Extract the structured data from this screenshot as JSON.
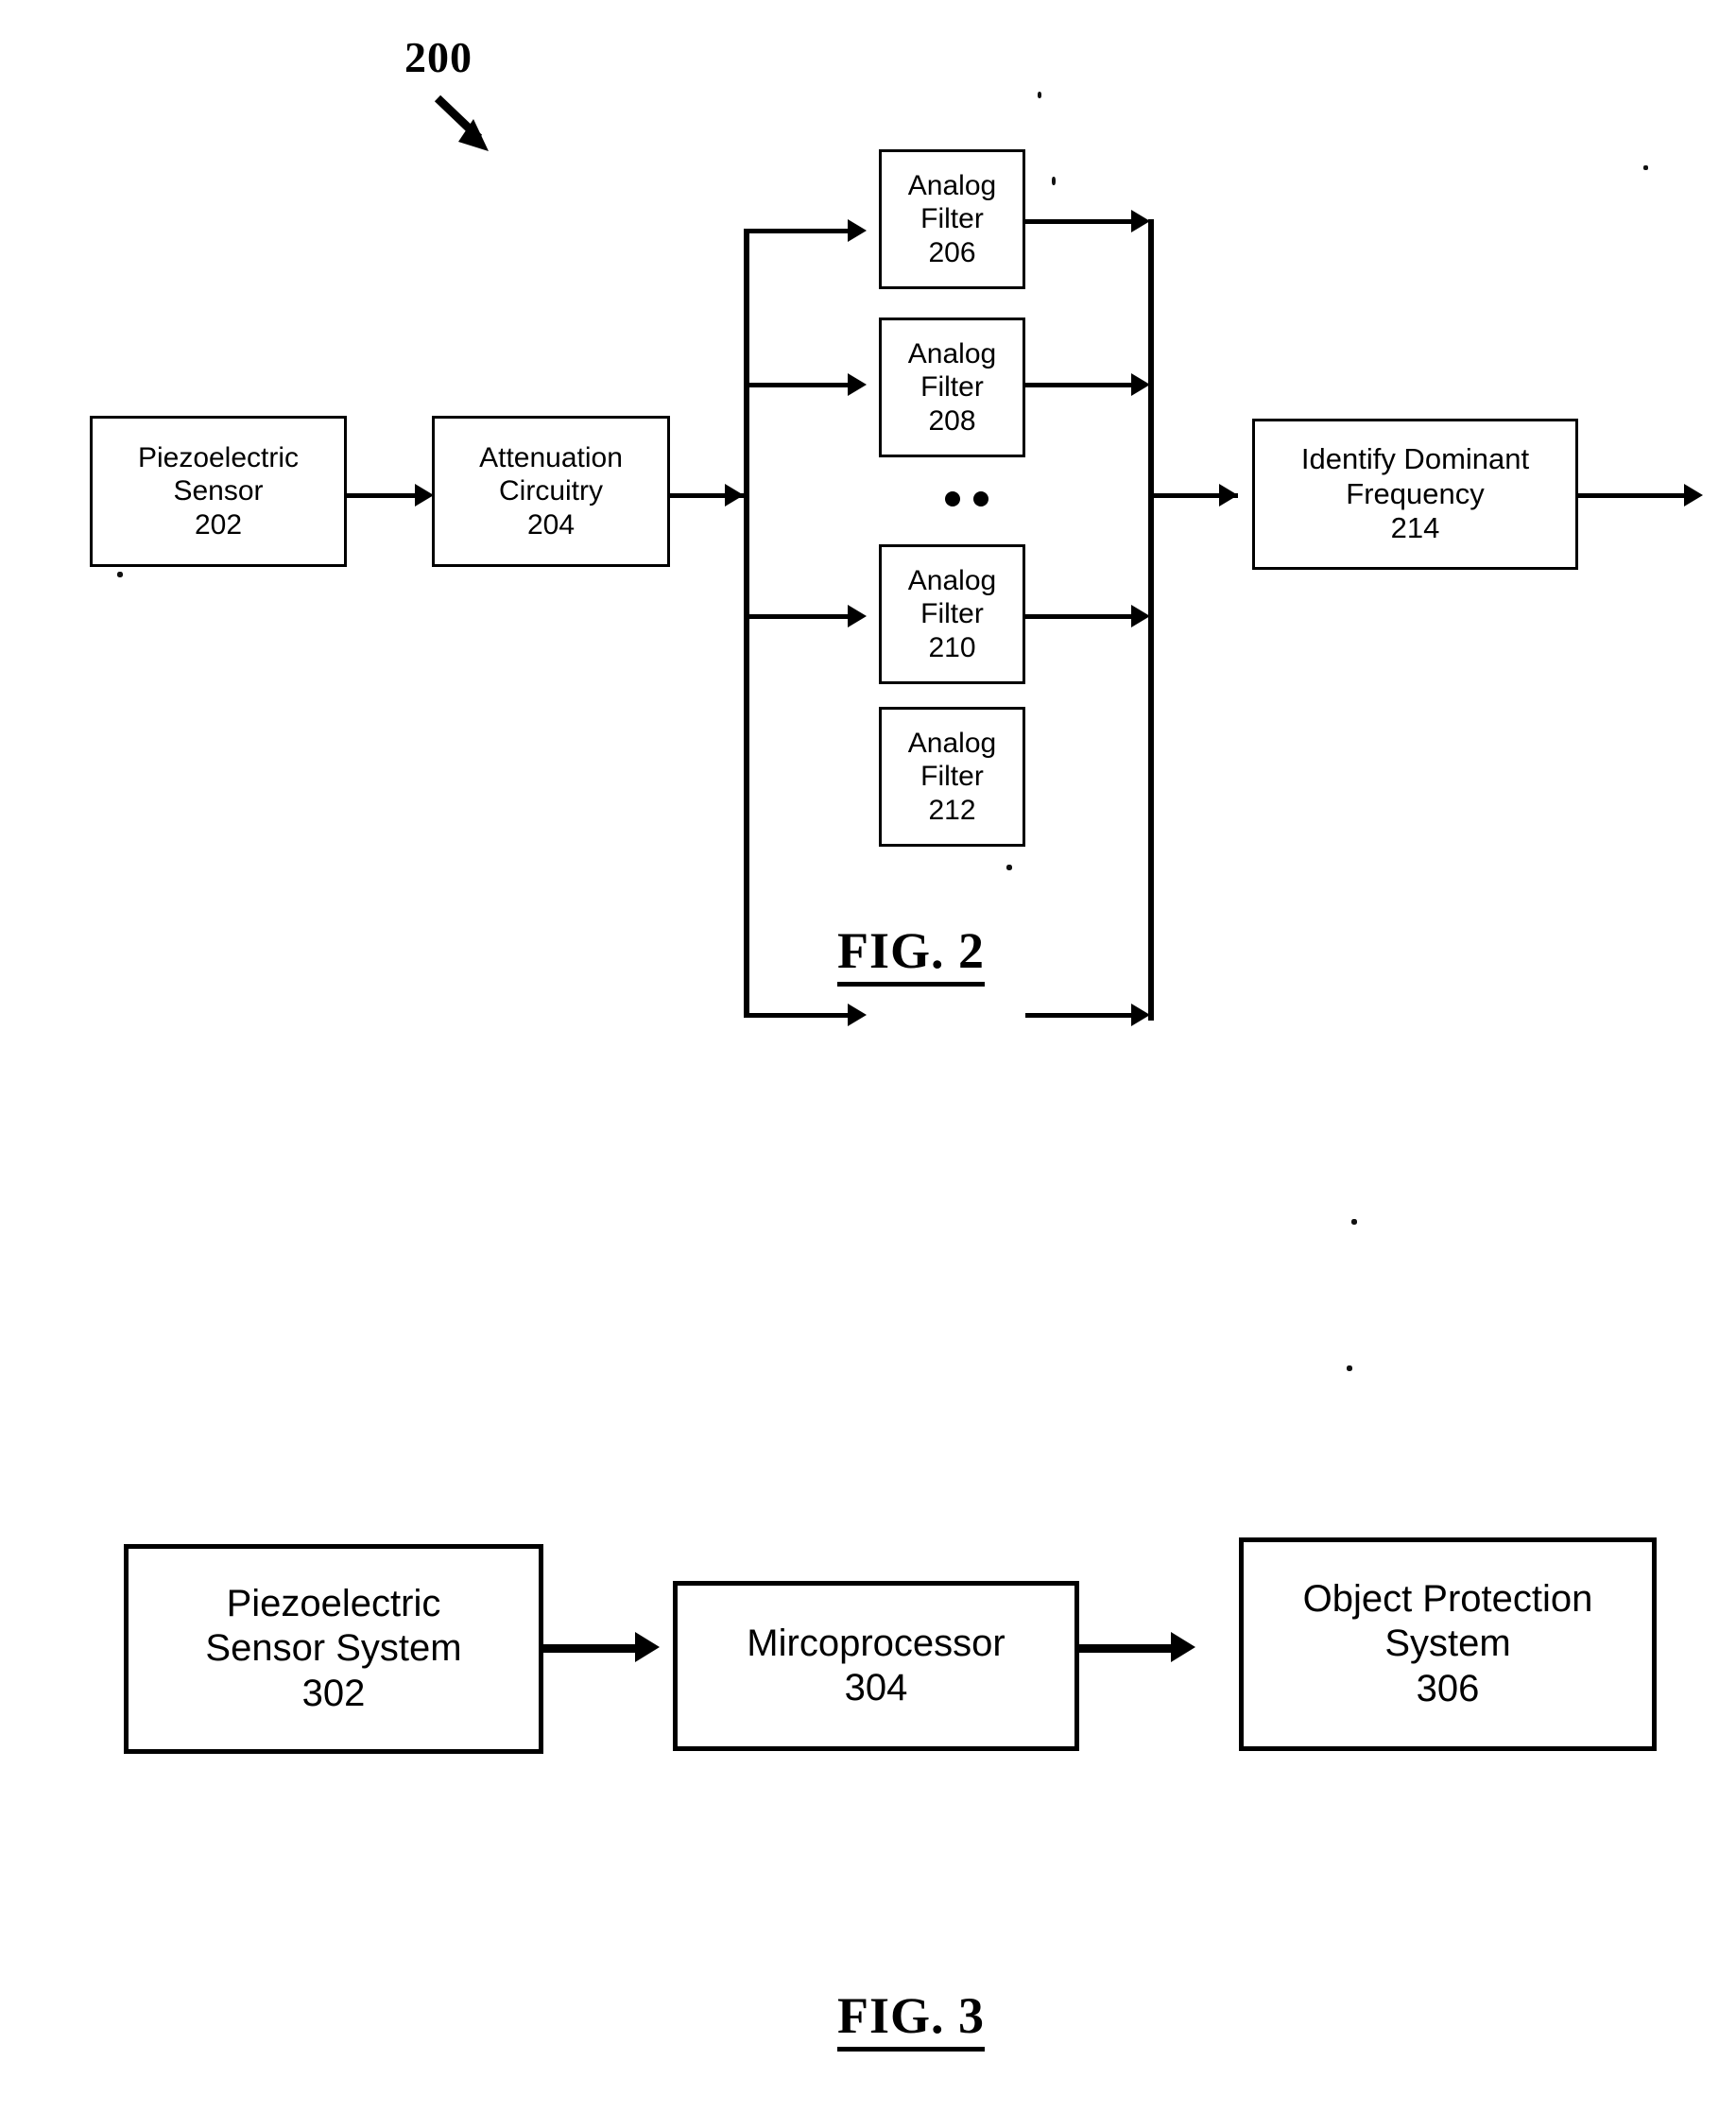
{
  "figure2": {
    "reference_numeral": "200",
    "caption": "FIG. 2",
    "boxes": {
      "sensor": {
        "line1": "Piezoelectric",
        "line2": "Sensor",
        "line3": "202"
      },
      "attenuation": {
        "line1": "Attenuation",
        "line2": "Circuitry",
        "line3": "204"
      },
      "filter206": {
        "line1": "Analog",
        "line2": "Filter",
        "line3": "206"
      },
      "filter208": {
        "line1": "Analog",
        "line2": "Filter",
        "line3": "208"
      },
      "filter210": {
        "line1": "Analog",
        "line2": "Filter",
        "line3": "210"
      },
      "filter212": {
        "line1": "Analog",
        "line2": "Filter",
        "line3": "212"
      },
      "identify": {
        "line1": "Identify Dominant",
        "line2": "Frequency",
        "line3": "214"
      }
    },
    "ellipsis_label": "continuation-dots"
  },
  "figure3": {
    "caption": "FIG. 3",
    "boxes": {
      "sensorSystem": {
        "line1": "Piezoelectric",
        "line2": "Sensor System",
        "line3": "302"
      },
      "microprocessor": {
        "line1": "Mircoprocessor",
        "line2": "304"
      },
      "objectProtection": {
        "line1": "Object Protection",
        "line2": "System",
        "line3": "306"
      }
    }
  },
  "colors": {
    "ink": "#000000",
    "paper": "#ffffff"
  }
}
